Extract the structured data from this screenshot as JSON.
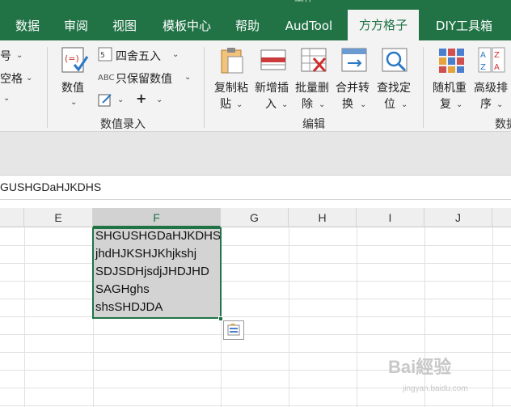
{
  "tabs": [
    "数据",
    "审阅",
    "视图",
    "模板中心",
    "帮助",
    "AudTool",
    "方方格子",
    "DIY工具箱"
  ],
  "ribbon": {
    "left_partial": [
      "号",
      "空格"
    ],
    "number_group": {
      "big_label": "数值",
      "round": "四舍五入",
      "keep_abc": "ABC",
      "keep": "只保留数值",
      "plus": "+",
      "group_label": "数值录入"
    },
    "edit_group": {
      "copy_paste": [
        "复制粘",
        "贴"
      ],
      "add_insert": [
        "新增插",
        "入"
      ],
      "batch_delete": [
        "批量删",
        "除"
      ],
      "merge_convert": [
        "合并转",
        "换"
      ],
      "find_locate": [
        "查找定",
        "位"
      ],
      "group_label": "编辑"
    },
    "data_group": {
      "random_repeat": [
        "随机重",
        "复"
      ],
      "advanced_sort": [
        "高级排",
        "序"
      ],
      "group_label_partial": "数据"
    }
  },
  "formula_bar": {
    "content": "GUSHGDaHJKDHS"
  },
  "columns": [
    "E",
    "F",
    "G",
    "H",
    "I",
    "J"
  ],
  "selected_column": "F",
  "cells": [
    "SHGUSHGDaHJKDHS",
    "jhdHJKSHJKhjkshj",
    "SDJSDHjsdjJHDJHD",
    "SAGHghs",
    "shsSHDJDA"
  ],
  "watermark": {
    "text": "Bai經验",
    "sub": "jingyan.baidu.com"
  },
  "colors": {
    "excel_green": "#217346",
    "selection_gray": "#d3d3d3"
  }
}
